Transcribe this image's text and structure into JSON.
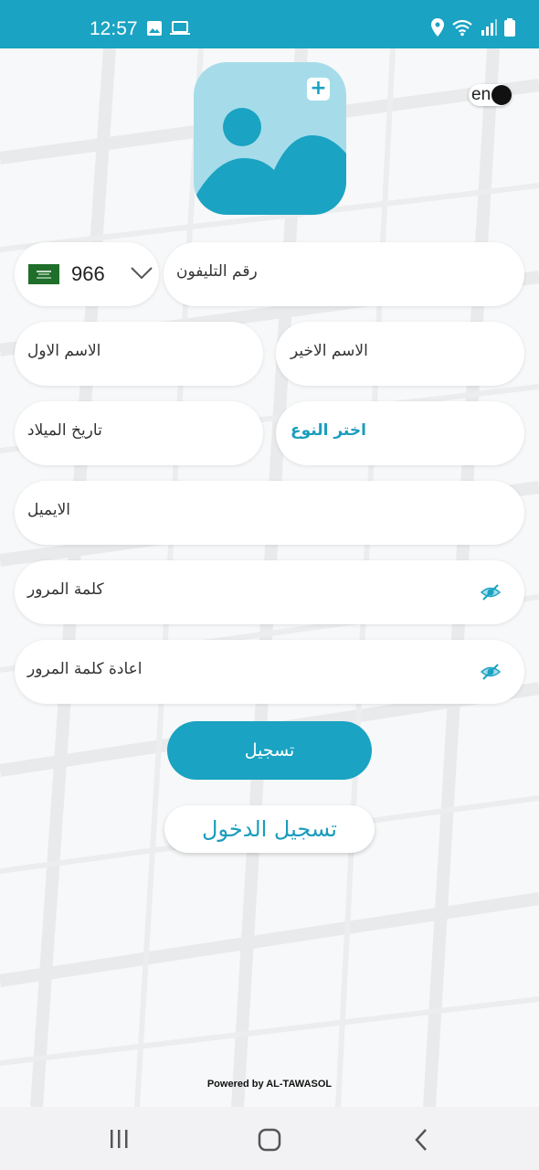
{
  "status_bar": {
    "time": "12:57",
    "left_icons": [
      "gallery-icon",
      "laptop-icon"
    ],
    "right_icons": [
      "location-icon",
      "wifi-icon",
      "signal-icon",
      "battery-icon"
    ]
  },
  "header": {
    "avatar_placeholder_icon": "image-icon",
    "avatar_add_symbol": "+",
    "language_toggle_label": "en"
  },
  "form": {
    "country_code": "966",
    "country_flag": "saudi-flag",
    "phone_placeholder": "رقم التليفون",
    "last_name_placeholder": "الاسم الاخير",
    "first_name_placeholder": "الاسم الاول",
    "gender_select_label": "اختر النوع",
    "birthdate_placeholder": "تاريخ الميلاد",
    "email_placeholder": "الايميل",
    "password_placeholder": "كلمة المرور",
    "confirm_password_placeholder": "اعادة كلمة المرور"
  },
  "actions": {
    "register_label": "تسجيل",
    "login_label": "تسجيل الدخول"
  },
  "footer": {
    "powered_by": "Powered by AL-TAWASOL"
  },
  "nav_bar": {
    "buttons": [
      "recent-apps-icon",
      "home-icon",
      "back-icon"
    ]
  },
  "colors": {
    "accent": "#1aa3c2",
    "avatar_bg": "#a6dcea",
    "login_text": "#1a9dbd"
  }
}
